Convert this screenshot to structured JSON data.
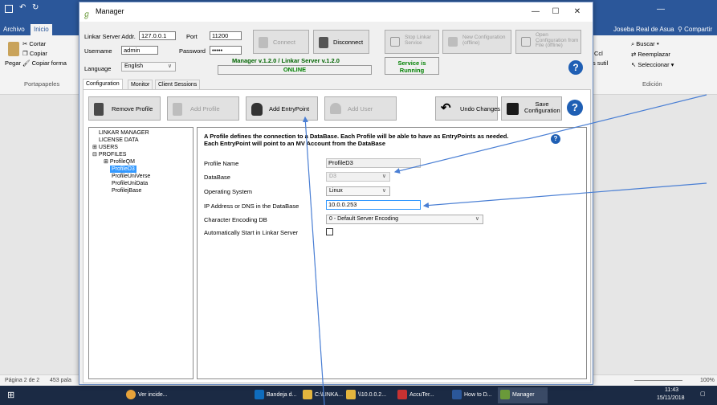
{
  "word": {
    "tabs": [
      "Archivo",
      "Inicio"
    ],
    "clipboard": {
      "cut": "Cortar",
      "copy": "Copiar",
      "paste": "Pegar",
      "format": "Copiar forma",
      "group": "Portapapeles"
    },
    "right": {
      "user": "Joseba Real de Asua",
      "share": "Compartir",
      "find": "Buscar",
      "replace": "Reemplazar",
      "select": "Seleccionar",
      "group": "Edición",
      "style": "Ccl",
      "sutil": "s sutil"
    },
    "status": {
      "page": "Página 2 de 2",
      "words": "453 pala",
      "zoom": "100%"
    }
  },
  "manager": {
    "title": "Manager",
    "server_label": "Linkar Server Addr.",
    "server_value": "127.0.0.1",
    "port_label": "Port",
    "port_value": "11200",
    "username_label": "Username",
    "username_value": "admin",
    "password_label": "Password",
    "password_value": "•••••",
    "language_label": "Language",
    "language_value": "English",
    "connect": "Connect",
    "disconnect": "Disconnect",
    "version": "Manager v.1.2.0 / Linkar Server v.1.2.0",
    "online": "ONLINE",
    "stop_service": "Stop Linkar Service",
    "new_config": "New Configuration (offline)",
    "open_config": "Open Configuration from File (offline)",
    "service_status": "Service is Running",
    "tabs": [
      "Configuration",
      "Monitor",
      "Client Sessions"
    ],
    "toolbar": {
      "remove_profile": "Remove Profile",
      "add_profile": "Add Profile",
      "add_entrypoint": "Add EntryPoint",
      "add_user": "Add User",
      "undo": "Undo Changes",
      "save": "Save Configuration"
    },
    "tree": {
      "root": "LINKAR MANAGER",
      "license": "LICENSE DATA",
      "users": "USERS",
      "profiles": "PROFILES",
      "profile_qm": "ProfileQM",
      "profile_d3": "ProfileD3",
      "profile_universe": "ProfileUniVerse",
      "profile_unidata": "ProfileUniData",
      "profile_jbase": "ProfilejBase"
    },
    "detail": {
      "desc1": "A Profile defines the connection to a DataBase. Each Profile will be able to have as EntryPoints as needed.",
      "desc2": "Each EntryPoint will point to an MV Account from the DataBase",
      "profile_name_label": "Profile Name",
      "profile_name_value": "ProfileD3",
      "database_label": "DataBase",
      "database_value": "D3",
      "os_label": "Operating System",
      "os_value": "Linux",
      "ip_label": "IP Address or DNS in the DataBase",
      "ip_value": "10.0.0.253",
      "encoding_label": "Character Encoding DB",
      "encoding_value": "0 - Default Server Encoding",
      "autostart_label": "Automatically Start in Linkar Server"
    }
  },
  "taskbar": {
    "items": [
      "Ver incide...",
      "Bandeja d...",
      "C:\\LINKA...",
      "\\\\10.0.0.2...",
      "AccuTer...",
      "How to D...",
      "Manager"
    ],
    "time": "11:43",
    "date": "15/11/2018"
  },
  "colors": {
    "word_blue": "#2b579a",
    "online_green": "#008000",
    "version_green": "#006400",
    "selected": "#3399ff",
    "arrow": "#4a7fd4"
  }
}
